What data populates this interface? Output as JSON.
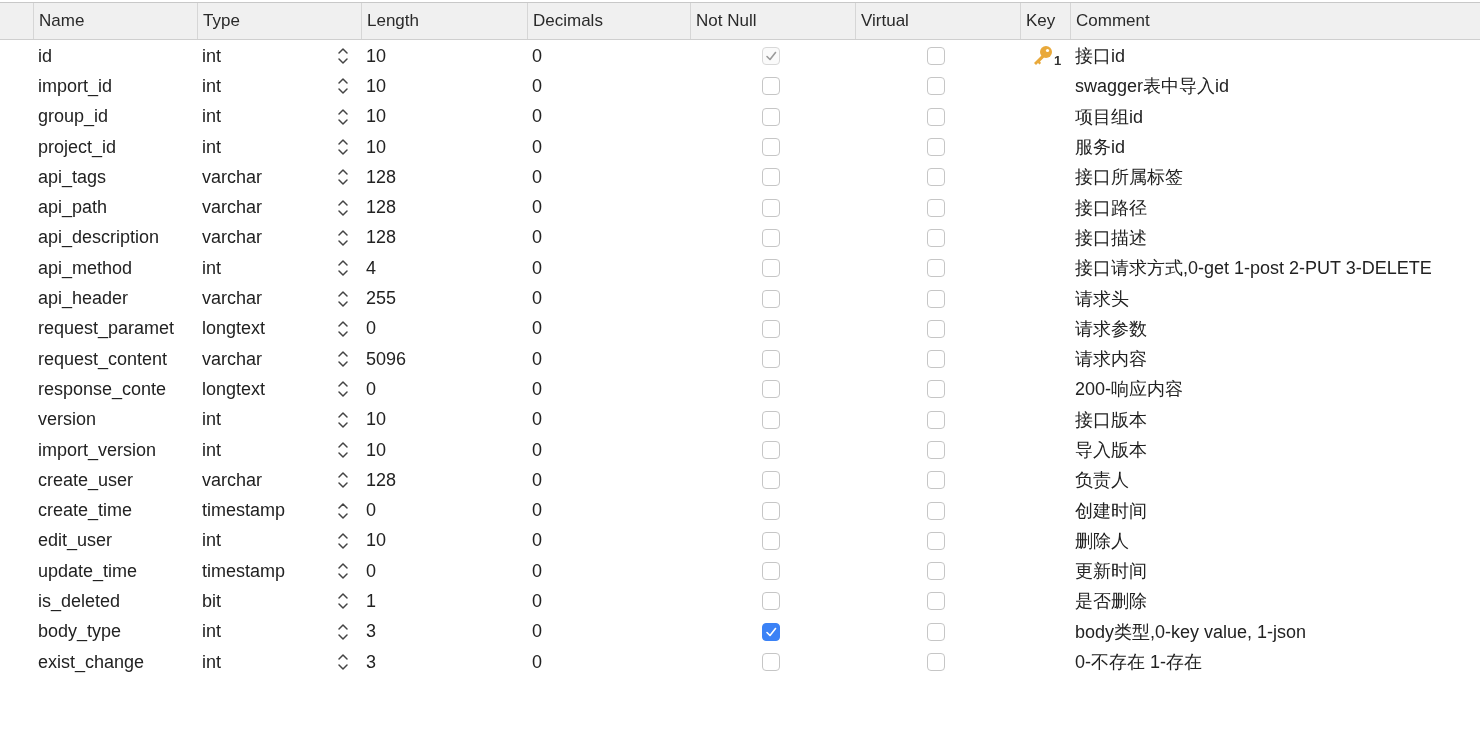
{
  "columns": [
    "Name",
    "Type",
    "Length",
    "Decimals",
    "Not Null",
    "Virtual",
    "Key",
    "Comment"
  ],
  "rows": [
    {
      "name": "id",
      "type": "int",
      "length": "10",
      "decimals": "0",
      "not_null": true,
      "not_null_disabled": true,
      "virtual": false,
      "primary_key": true,
      "key_order": "1",
      "comment": "接口id"
    },
    {
      "name": "import_id",
      "type": "int",
      "length": "10",
      "decimals": "0",
      "not_null": false,
      "not_null_disabled": false,
      "virtual": false,
      "primary_key": false,
      "comment": "swagger表中导入id"
    },
    {
      "name": "group_id",
      "type": "int",
      "length": "10",
      "decimals": "0",
      "not_null": false,
      "not_null_disabled": false,
      "virtual": false,
      "primary_key": false,
      "comment": "项目组id"
    },
    {
      "name": "project_id",
      "type": "int",
      "length": "10",
      "decimals": "0",
      "not_null": false,
      "not_null_disabled": false,
      "virtual": false,
      "primary_key": false,
      "comment": "服务id"
    },
    {
      "name": "api_tags",
      "type": "varchar",
      "length": "128",
      "decimals": "0",
      "not_null": false,
      "not_null_disabled": false,
      "virtual": false,
      "primary_key": false,
      "comment": "接口所属标签"
    },
    {
      "name": "api_path",
      "type": "varchar",
      "length": "128",
      "decimals": "0",
      "not_null": false,
      "not_null_disabled": false,
      "virtual": false,
      "primary_key": false,
      "comment": "接口路径"
    },
    {
      "name": "api_description",
      "type": "varchar",
      "length": "128",
      "decimals": "0",
      "not_null": false,
      "not_null_disabled": false,
      "virtual": false,
      "primary_key": false,
      "comment": "接口描述"
    },
    {
      "name": "api_method",
      "type": "int",
      "length": "4",
      "decimals": "0",
      "not_null": false,
      "not_null_disabled": false,
      "virtual": false,
      "primary_key": false,
      "comment": "接口请求方式,0-get 1-post 2-PUT 3-DELETE"
    },
    {
      "name": "api_header",
      "type": "varchar",
      "length": "255",
      "decimals": "0",
      "not_null": false,
      "not_null_disabled": false,
      "virtual": false,
      "primary_key": false,
      "comment": "请求头"
    },
    {
      "name": "request_paramet",
      "type": "longtext",
      "length": "0",
      "decimals": "0",
      "not_null": false,
      "not_null_disabled": false,
      "virtual": false,
      "primary_key": false,
      "comment": "请求参数"
    },
    {
      "name": "request_content",
      "type": "varchar",
      "length": "5096",
      "decimals": "0",
      "not_null": false,
      "not_null_disabled": false,
      "virtual": false,
      "primary_key": false,
      "comment": "请求内容"
    },
    {
      "name": "response_conte",
      "type": "longtext",
      "length": "0",
      "decimals": "0",
      "not_null": false,
      "not_null_disabled": false,
      "virtual": false,
      "primary_key": false,
      "comment": "200-响应内容"
    },
    {
      "name": "version",
      "type": "int",
      "length": "10",
      "decimals": "0",
      "not_null": false,
      "not_null_disabled": false,
      "virtual": false,
      "primary_key": false,
      "comment": "接口版本"
    },
    {
      "name": "import_version",
      "type": "int",
      "length": "10",
      "decimals": "0",
      "not_null": false,
      "not_null_disabled": false,
      "virtual": false,
      "primary_key": false,
      "comment": "导入版本"
    },
    {
      "name": "create_user",
      "type": "varchar",
      "length": "128",
      "decimals": "0",
      "not_null": false,
      "not_null_disabled": false,
      "virtual": false,
      "primary_key": false,
      "comment": "负责人"
    },
    {
      "name": "create_time",
      "type": "timestamp",
      "length": "0",
      "decimals": "0",
      "not_null": false,
      "not_null_disabled": false,
      "virtual": false,
      "primary_key": false,
      "comment": "创建时间"
    },
    {
      "name": "edit_user",
      "type": "int",
      "length": "10",
      "decimals": "0",
      "not_null": false,
      "not_null_disabled": false,
      "virtual": false,
      "primary_key": false,
      "comment": "删除人"
    },
    {
      "name": "update_time",
      "type": "timestamp",
      "length": "0",
      "decimals": "0",
      "not_null": false,
      "not_null_disabled": false,
      "virtual": false,
      "primary_key": false,
      "comment": "更新时间"
    },
    {
      "name": "is_deleted",
      "type": "bit",
      "length": "1",
      "decimals": "0",
      "not_null": false,
      "not_null_disabled": false,
      "virtual": false,
      "primary_key": false,
      "comment": "是否删除"
    },
    {
      "name": "body_type",
      "type": "int",
      "length": "3",
      "decimals": "0",
      "not_null": true,
      "not_null_disabled": false,
      "virtual": false,
      "primary_key": false,
      "comment": "body类型,0-key value, 1-json"
    },
    {
      "name": "exist_change",
      "type": "int",
      "length": "3",
      "decimals": "0",
      "not_null": false,
      "not_null_disabled": false,
      "virtual": false,
      "primary_key": false,
      "comment": "0-不存在 1-存在"
    }
  ]
}
